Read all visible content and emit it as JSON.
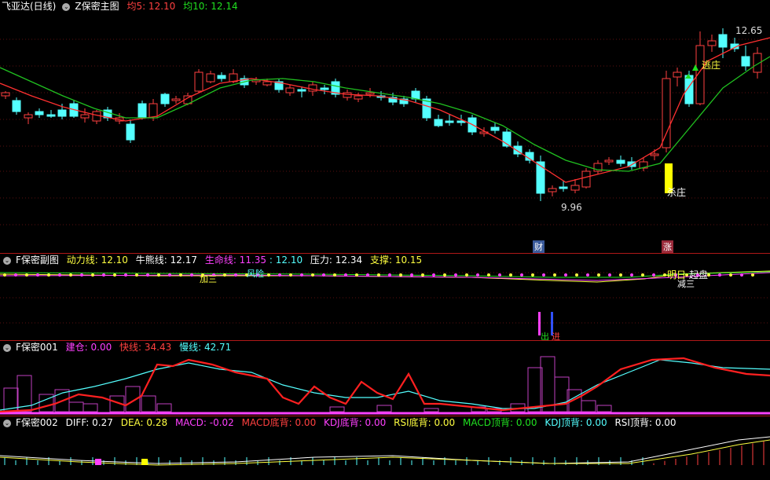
{
  "main": {
    "stock": "飞亚达(日线)",
    "indicator": "Z保密主图",
    "ma5_label": "均5: 12.10",
    "ma10_label": "均10: 12.14",
    "high_label": "12.65",
    "low_label": "9.96",
    "tag_escape": "逃庄",
    "tag_kill": "杀庄",
    "badge_cai": "财",
    "badge_zhang": "涨",
    "colors": {
      "up": "#ff4040",
      "down": "#54ffff",
      "ma5": "#ff3030",
      "ma10": "#20c020"
    }
  },
  "sub1": {
    "title": "F保密副图",
    "v1": "动力线: 12.10",
    "v2": "牛熊线: 12.17",
    "v3": "生命线: 11.35",
    "v4": ": 12.10",
    "v5": "压力: 12.34",
    "v6": "支撑: 10.15",
    "mark_jiasan": "加三",
    "mark_fengxian": "风险",
    "mark_mingri": "明日",
    "mark_qipan": "起盘",
    "mark_jiasan2": "减三",
    "mark_chu": "出",
    "mark_jin": "进"
  },
  "sub2": {
    "title": "F保密001",
    "v1": "建仓: 0.00",
    "v2": "快线: 34.43",
    "v3": "慢线: 42.71"
  },
  "sub3": {
    "title": "F保密002",
    "v1": "DIFF: 0.27",
    "v2": "DEA: 0.28",
    "v3": "MACD: -0.02",
    "v4": "MACD底背: 0.00",
    "v5": "KDJ底背: 0.00",
    "v6": "RSI底背: 0.00",
    "v7": "MACD顶背: 0.00",
    "v8": "KDJ顶背: 0.00",
    "v9": "RSI顶背: 0.00"
  }
}
